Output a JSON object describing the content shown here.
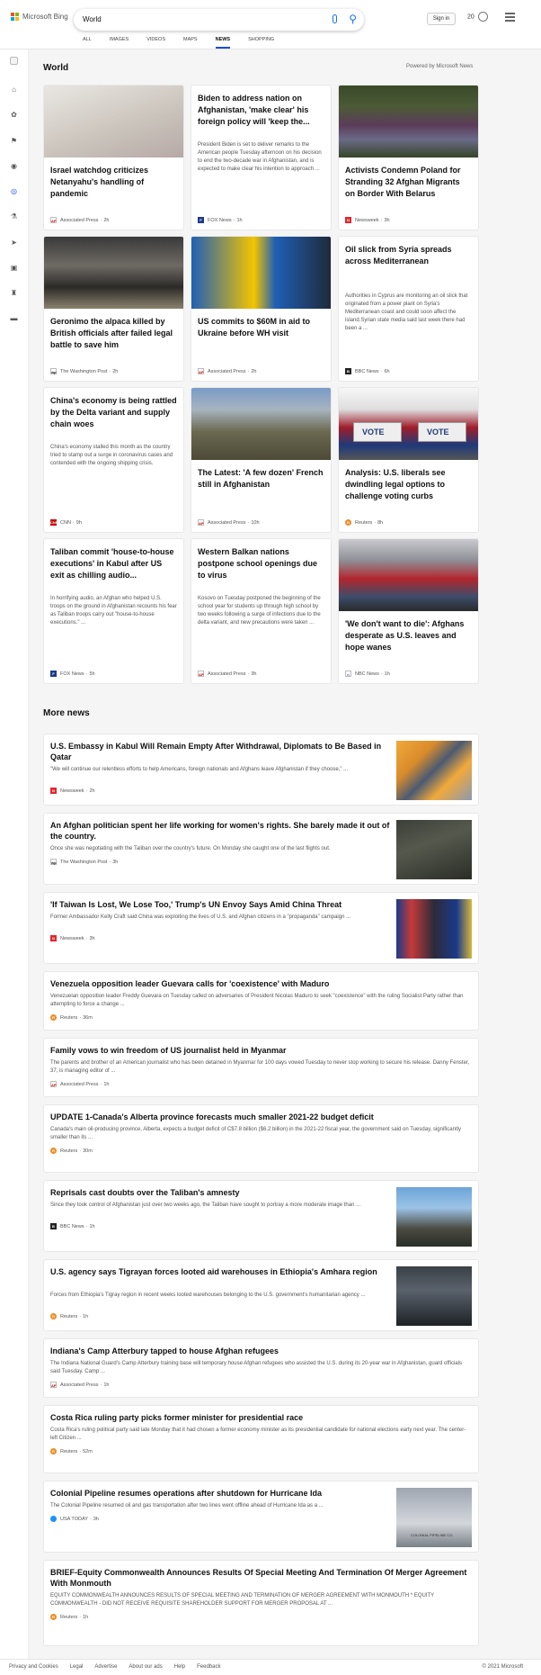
{
  "header": {
    "logo_text": "Microsoft Bing",
    "search_value": "World",
    "signin_label": "Sign in",
    "rewards_count": "20",
    "tabs": [
      "ALL",
      "IMAGES",
      "VIDEOS",
      "MAPS",
      "NEWS",
      "SHOPPING"
    ],
    "active_tab": "NEWS"
  },
  "world": {
    "title": "World",
    "powered_by": "Powered by Microsoft News",
    "cards": [
      {
        "title": "Israel watchdog criticizes Netanyahu's handling of pandemic",
        "snippet": "",
        "source": "Associated Press",
        "time": "2h",
        "has_image": true
      },
      {
        "title": "Biden to address nation on Afghanistan, 'make clear' his foreign policy will 'keep the...",
        "snippet": "President Biden is set to deliver remarks to the American people Tuesday afternoon on his decision to end the two-decade war in Afghanistan, and is expected to make clear his intention to approach ...",
        "source": "FOX News",
        "time": "1h",
        "has_image": false
      },
      {
        "title": "Activists Condemn Poland for Stranding 32 Afghan Migrants on Border With Belarus",
        "snippet": "",
        "source": "Newsweek",
        "time": "3h",
        "has_image": true
      },
      {
        "title": "Geronimo the alpaca killed by British officials after failed legal battle to save him",
        "snippet": "",
        "source": "The Washington Post",
        "time": "2h",
        "has_image": true
      },
      {
        "title": "US commits to $60M in aid to Ukraine before WH visit",
        "snippet": "",
        "source": "Associated Press",
        "time": "2h",
        "has_image": true
      },
      {
        "title": "Oil slick from Syria spreads across Mediterranean",
        "snippet": "Authorities in Cyprus are monitoring an oil slick that originated from a power plant on Syria's Mediterranean coast and could soon affect the island.Syrian state media said last week there had been a ...",
        "source": "BBC News",
        "time": "6h",
        "has_image": false
      },
      {
        "title": "China's economy is being rattled by the Delta variant and supply chain woes",
        "snippet": "China's economy stalled this month as the country tried to stamp out a surge in coronavirus cases and contended with the ongoing shipping crisis.",
        "source": "CNN",
        "time": "9h",
        "has_image": false
      },
      {
        "title": "The Latest: 'A few dozen' French still in Afghanistan",
        "snippet": "",
        "source": "Associated Press",
        "time": "10h",
        "has_image": true
      },
      {
        "title": "Analysis: U.S. liberals see dwindling legal options to challenge voting curbs",
        "snippet": "",
        "source": "Reuters",
        "time": "8h",
        "has_image": true
      },
      {
        "title": "Taliban commit 'house-to-house executions' in Kabul after US exit as chilling audio...",
        "snippet": "In horrifying audio, an Afghan who helped U.S. troops on the ground in Afghanistan recounts his fear as Taliban troops carry out \"house-to-house executions.\" ...",
        "source": "FOX News",
        "time": "5h",
        "has_image": false
      },
      {
        "title": "Western Balkan nations postpone school openings due to virus",
        "snippet": "Kosovo on Tuesday postponed the beginning of the school year for students up through high school by two weeks following a surge of infections due to the delta variant, and new precautions were taken ...",
        "source": "Associated Press",
        "time": "3h",
        "has_image": false
      },
      {
        "title": "'We don't want to die': Afghans desperate as U.S. leaves and hope wanes",
        "snippet": "",
        "source": "NBC News",
        "time": "1h",
        "has_image": true
      }
    ]
  },
  "more_news": {
    "title": "More news",
    "items": [
      {
        "title": "U.S. Embassy in Kabul Will Remain Empty After Withdrawal, Diplomats to Be Based in Qatar",
        "snippet": "\"We will continue our relentless efforts to help Americans, foreign nationals and Afghans leave Afghanistan if they choose,\" ...",
        "source": "Newsweek",
        "time": "2h",
        "has_image": true
      },
      {
        "title": "An Afghan politician spent her life working for women's rights. She barely made it out of the country.",
        "snippet": "Once she was negotiating with the Taliban over the country's future. On Monday she caught one of the last flights out.",
        "source": "The Washington Post",
        "time": "3h",
        "has_image": true
      },
      {
        "title": "'If Taiwan Is Lost, We Lose Too,' Trump's UN Envoy Says Amid China Threat",
        "snippet": "Former Ambassador Kelly Craft said China was exploiting the lives of U.S. and Afghan citizens in a \"propaganda\" campaign ...",
        "source": "Newsweek",
        "time": "3h",
        "has_image": true
      },
      {
        "title": "Venezuela opposition leader Guevara calls for 'coexistence' with Maduro",
        "snippet": "Venezuelan opposition leader Freddy Guevara on Tuesday called on adversaries of President Nicolas Maduro to seek \"coexistence\" with the ruling Socialist Party rather than attempting to force a change ...",
        "source": "Reuters",
        "time": "36m",
        "has_image": false
      },
      {
        "title": "Family vows to win freedom of US journalist held in Myanmar",
        "snippet": "The parents and brother of an American journalist who has been detained in Myanmar for 100 days vowed Tuesday to never stop working to secure his release. Danny Fenster, 37, is managing editor of ...",
        "source": "Associated Press",
        "time": "1h",
        "has_image": false
      },
      {
        "title": "UPDATE 1-Canada's Alberta province forecasts much smaller 2021-22 budget deficit",
        "snippet": "Canada's main oil-producing province, Alberta, expects a budget deficit of C$7.8 billion ($6.2 billion) in the 2021-22 fiscal year, the government said on Tuesday, significantly smaller than its ...",
        "source": "Reuters",
        "time": "30m",
        "has_image": false
      },
      {
        "title": "Reprisals cast doubts over the Taliban's amnesty",
        "snippet": "Since they took control of Afghanistan just over two weeks ago, the Taliban have sought to portray a more moderate image than ...",
        "source": "BBC News",
        "time": "1h",
        "has_image": true
      },
      {
        "title": "U.S. agency says Tigrayan forces looted aid warehouses in Ethiopia's Amhara region",
        "snippet": "Forces from Ethiopia's Tigray region in recent weeks looted warehouses belonging to the U.S. government's humanitarian agency ...",
        "source": "Reuters",
        "time": "1h",
        "has_image": true
      },
      {
        "title": "Indiana's Camp Atterbury tapped to house Afghan refugees",
        "snippet": "The Indiana National Guard's Camp Atterbury training base will temporary house Afghan refugees who assisted the U.S. during its 20-year war in Afghanistan, guard officials said Tuesday. Camp ...",
        "source": "Associated Press",
        "time": "1h",
        "has_image": false
      },
      {
        "title": "Costa Rica ruling party picks former minister for presidential race",
        "snippet": "Costa Rica's ruling political party said late Monday that it had chosen a former economy minister as its presidential candidate for national elections early next year. The center-left Citizen ...",
        "source": "Reuters",
        "time": "52m",
        "has_image": false
      },
      {
        "title": "Colonial Pipeline resumes operations after shutdown for Hurricane Ida",
        "snippet": "The Colonial Pipeline resumed oil and gas transportation after two lines went offline ahead of Hurricane Ida as a ...",
        "source": "USA TODAY",
        "time": "3h",
        "has_image": true
      },
      {
        "title": "BRIEF-Equity Commonwealth Announces Results Of Special Meeting And Termination Of Merger Agreement With Monmouth",
        "snippet": "EQUITY COMMONWEALTH ANNOUNCES RESULTS OF SPECIAL MEETING AND TERMINATION OF MERGER AGREEMENT WITH MONMOUTH * EQUITY COMMONWEALTH - DID NOT RECEIVE REQUISITE SHAREHOLDER SUPPORT FOR MERGER PROPOSAL AT ...",
        "source": "Reuters",
        "time": "1h",
        "has_image": false
      }
    ]
  },
  "thumb_labels": {
    "vote": "VOTE",
    "pipeline_sign": "COLONIAL PIPELINE CO."
  },
  "footer": {
    "links": [
      "Privacy and Cookies",
      "Legal",
      "Advertise",
      "About our ads",
      "Help",
      "Feedback"
    ],
    "copyright": "© 2021 Microsoft"
  }
}
